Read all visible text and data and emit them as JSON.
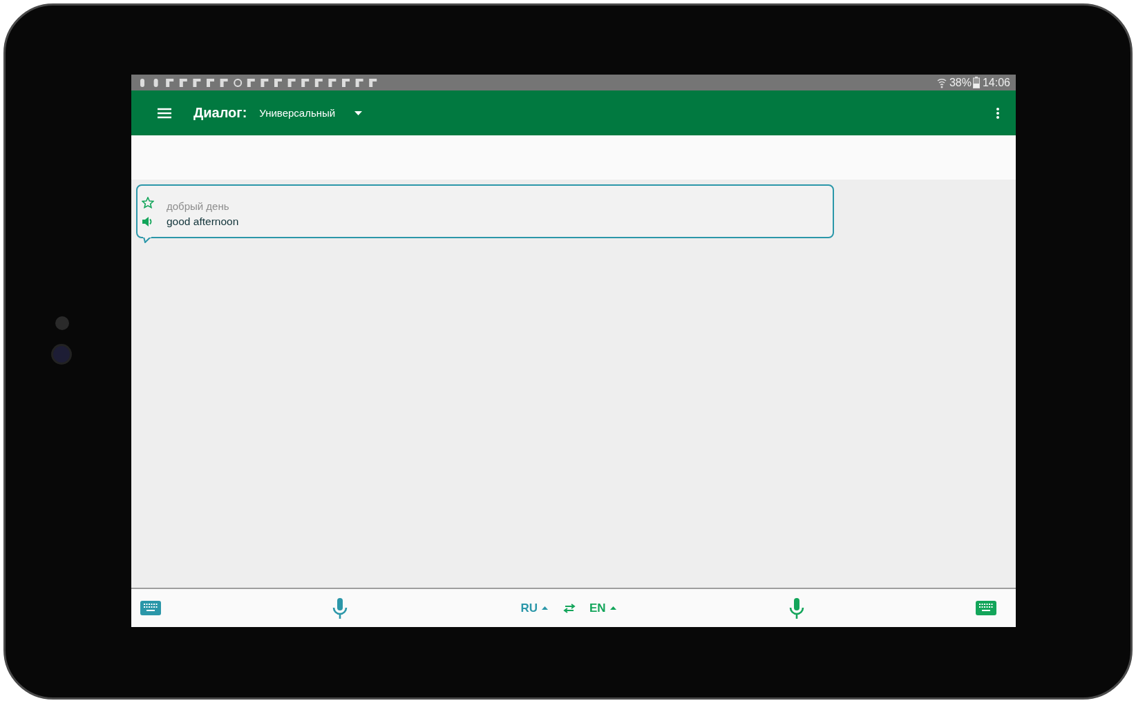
{
  "status_bar": {
    "battery": "38%",
    "time": "14:06"
  },
  "toolbar": {
    "title": "Диалог:",
    "dialog_type": "Универсальный"
  },
  "messages": [
    {
      "source": "добрый день",
      "translation": "good afternoon",
      "starred": false
    }
  ],
  "bottom_bar": {
    "source_language": "RU",
    "target_language": "EN"
  }
}
